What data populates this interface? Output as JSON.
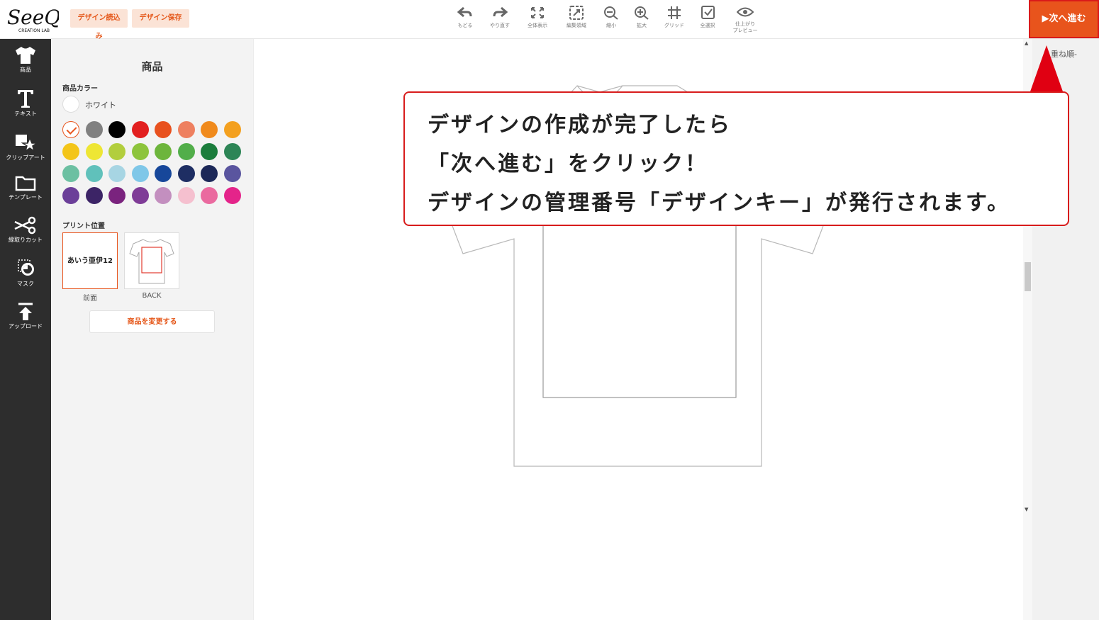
{
  "header": {
    "logo_text": "SeeQ",
    "logo_sub": "CREATION LAB",
    "load_button": "デザイン読込み",
    "save_button": "デザイン保存",
    "tools": [
      {
        "label": "もどる",
        "icon": "undo-icon"
      },
      {
        "label": "やり直す",
        "icon": "redo-icon"
      },
      {
        "label": "全体表示",
        "icon": "fit-view-icon"
      },
      {
        "label": "編集領域",
        "icon": "edit-area-icon"
      },
      {
        "label": "縮小",
        "icon": "zoom-out-icon"
      },
      {
        "label": "拡大",
        "icon": "zoom-in-icon"
      },
      {
        "label": "グリッド",
        "icon": "grid-icon"
      },
      {
        "label": "全選択",
        "icon": "select-all-icon"
      },
      {
        "label": "仕上がり\nプレビュー",
        "icon": "eye-icon"
      }
    ],
    "next_button": "▶次へ進む"
  },
  "sidebar": {
    "items": [
      {
        "label": "商品",
        "icon": "tshirt-icon"
      },
      {
        "label": "テキスト",
        "icon": "text-icon"
      },
      {
        "label": "クリップアート",
        "icon": "clipart-icon"
      },
      {
        "label": "テンプレート",
        "icon": "folder-icon"
      },
      {
        "label": "縁取りカット",
        "icon": "scissors-icon"
      },
      {
        "label": "マスク",
        "icon": "mask-icon"
      },
      {
        "label": "アップロード",
        "icon": "upload-icon"
      }
    ]
  },
  "panel": {
    "title": "商品",
    "color_label": "商品カラー",
    "current_color": "ホワイト",
    "swatches": [
      "#ffffff",
      "#808080",
      "#000000",
      "#e21f1f",
      "#e8511e",
      "#ee8060",
      "#f08a1c",
      "#f3a01f",
      "#f3c519",
      "#eee634",
      "#b2ce3d",
      "#8dc43c",
      "#6db53c",
      "#52ae4a",
      "#1b7d3c",
      "#2d8556",
      "#6cc0a2",
      "#60c1bb",
      "#a7d5e3",
      "#7fc7e8",
      "#17479a",
      "#1e2e63",
      "#1c2858",
      "#5a559f",
      "#6b3f99",
      "#3c2466",
      "#7a237e",
      "#7f3c97",
      "#c38fbf",
      "#f5c0cf",
      "#ea6a9f",
      "#e4248a"
    ],
    "selected_swatch": 0,
    "print_label": "プリント位置",
    "front_text": "あいう亜伊12",
    "front_label": "前面",
    "back_label": "BACK",
    "change_product": "商品を変更する"
  },
  "right_panel": {
    "layer_label": "重ね順-"
  },
  "callout": {
    "lines": [
      "デザインの作成が完了したら",
      "「次へ進む」をクリック！",
      "デザインの管理番号「デザインキー」が発行されます。"
    ],
    "border_color": "#d81c1c",
    "arrow_color": "#e00012"
  },
  "colors": {
    "accent": "#e8541c",
    "sidebar_bg": "#2d2d2d"
  }
}
